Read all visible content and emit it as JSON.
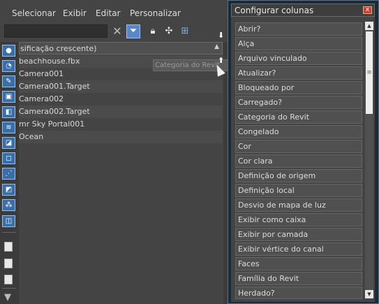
{
  "menu": [
    "Selecionar",
    "Exibir",
    "Editar",
    "Personalizar"
  ],
  "toolbar": {
    "clear_icon": "close-icon",
    "filter_icon": "filter-icon",
    "lock_icon": "lock-icon",
    "add_icon": "add-cursor-icon",
    "hierarchy_icon": "hierarchy-icon"
  },
  "column_header": {
    "label": "sificação crescente)",
    "sort_icon": "sort-up-icon"
  },
  "objects": [
    "beachhouse.fbx",
    "Camera001",
    "Camera001.Target",
    "Camera002",
    "Camera002.Target",
    "mr Sky Portal001",
    "Ocean"
  ],
  "tooltip": "Categoria do Revit",
  "dialog": {
    "title": "Configurar colunas",
    "close_label": "x",
    "columns": [
      "Abrir?",
      "Alça",
      "Arquivo vinculado",
      "Atualizar?",
      "Bloqueado por",
      "Carregado?",
      "Categoria do Revit",
      "Congelado",
      "Cor",
      "Cor clara",
      "Definição de origem",
      "Definição local",
      "Desvio de mapa de luz",
      "Exibir como caixa",
      "Exibir por camada",
      "Exibir vértice do canal",
      "Faces",
      "Família do Revit",
      "Herdado?"
    ]
  },
  "colors": {
    "accent": "#5a87c6",
    "panel_bg": "#444444",
    "dialog_frame": "#1c2a38",
    "close_red": "#c6432f"
  }
}
